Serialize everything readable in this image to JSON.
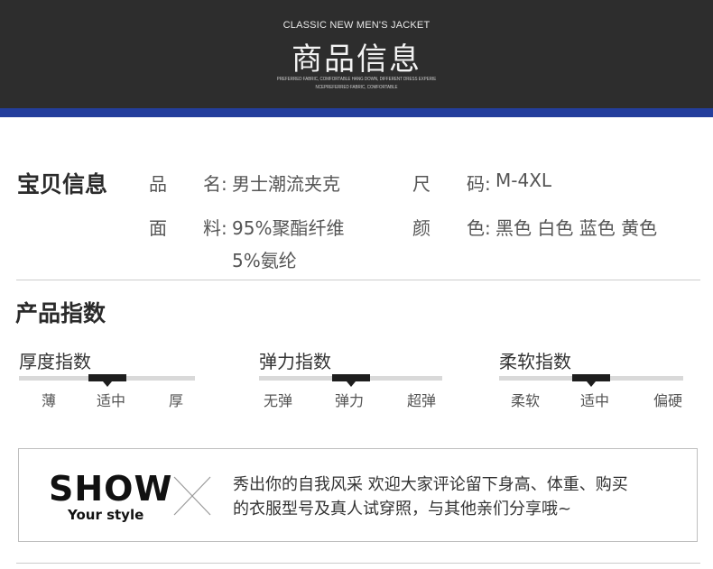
{
  "banner": {
    "en_title": "CLASSIC NEW MEN'S JACKET",
    "cn_title": "商品信息",
    "sub_line1": "PREFERRED FABRIC, COMFORTABLE HANG DOWN, DIFFERENT DRESS EXPERIE",
    "sub_line2": "NCEPREFERRED FABRIC, COMFORTABLE",
    "stripe_color": "#233e9c"
  },
  "info": {
    "title": "宝贝信息",
    "name_key": "品　　名:",
    "name_value": "男士潮流夹克",
    "size_key": "尺　　码:",
    "size_value": "M-4XL",
    "material_key": "面　　料:",
    "material_value_line1": "95%聚酯纤维",
    "material_value_line2": "5%氨纶",
    "color_key": "颜　　色:",
    "color_value": "黑色 白色 蓝色 黄色"
  },
  "indices": {
    "title": "产品指数",
    "items": [
      {
        "title": "厚度指数",
        "labels": [
          "薄",
          "适中",
          "厚"
        ],
        "selected": 1
      },
      {
        "title": "弹力指数",
        "labels": [
          "无弹",
          "弹力",
          "超弹"
        ],
        "selected": 1
      },
      {
        "title": "柔软指数",
        "labels": [
          "柔软",
          "适中",
          "偏硬"
        ],
        "selected": 1
      }
    ]
  },
  "show": {
    "word": "SHOW",
    "sub": "Your style",
    "message_line1": "秀出你的自我风采  欢迎大家评论留下身高、体重、购买",
    "message_line2": "的衣服型号及真人试穿照，与其他亲们分享哦~"
  }
}
